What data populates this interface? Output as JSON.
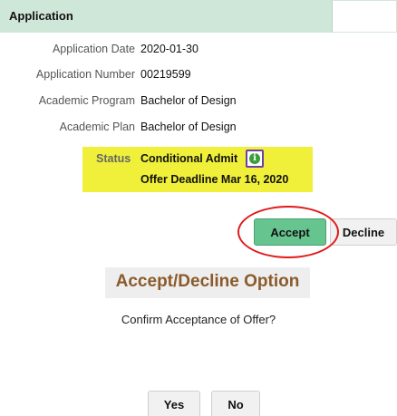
{
  "header": {
    "title": "Application"
  },
  "fields": [
    {
      "label": "Application Date",
      "value": "2020-01-30"
    },
    {
      "label": "Application Number",
      "value": "00219599"
    },
    {
      "label": "Academic Program",
      "value": "Bachelor of Design"
    },
    {
      "label": "Academic Plan",
      "value": "Bachelor of Design"
    }
  ],
  "status": {
    "label": "Status",
    "value": "Conditional Admit",
    "deadline": "Offer Deadline Mar 16, 2020",
    "icon": "info-icon",
    "highlight_color": "#f0f03a"
  },
  "actions": {
    "accept_label": "Accept",
    "decline_label": "Decline"
  },
  "dialog": {
    "title": "Accept/Decline Option",
    "question": "Confirm Acceptance of Offer?",
    "yes_label": "Yes",
    "no_label": "No"
  },
  "colors": {
    "header_bg": "#cfe7d9",
    "accept_bg": "#66c48f",
    "annotation_circle": "#e01b1b",
    "dialog_title": "#8a5a2b"
  }
}
